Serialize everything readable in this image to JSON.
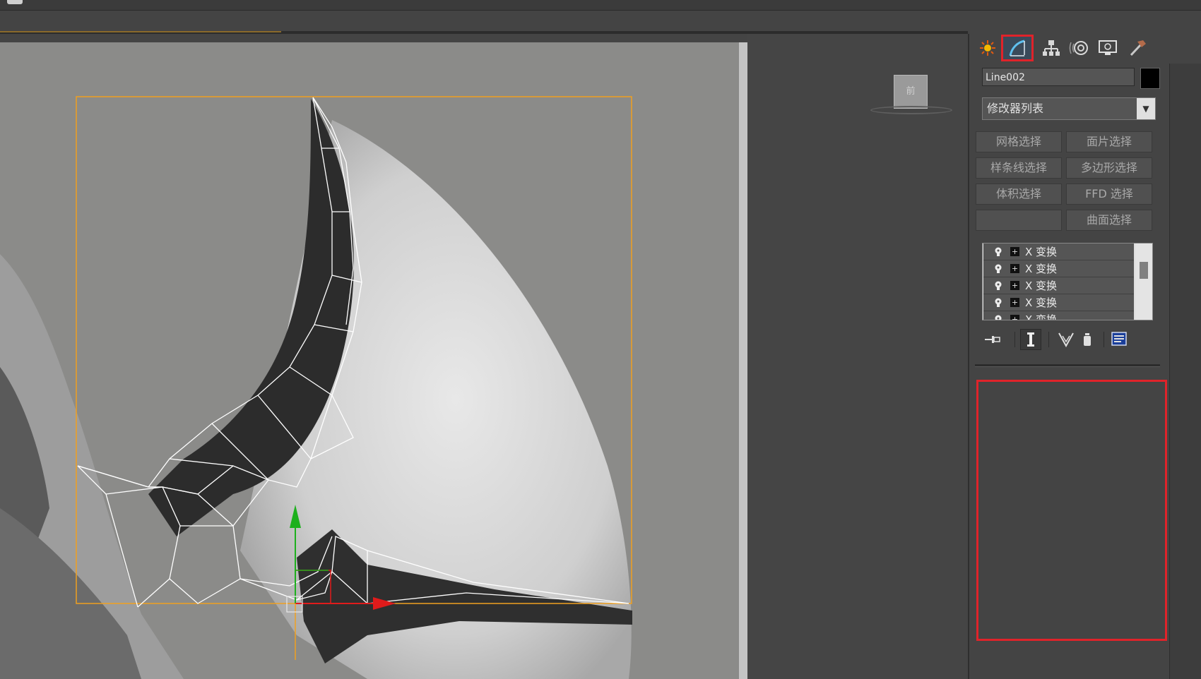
{
  "command_panel": {
    "tabs": [
      {
        "name": "create",
        "icon": "create-icon",
        "active": false
      },
      {
        "name": "modify",
        "icon": "modify-icon",
        "active": true
      },
      {
        "name": "hierarchy",
        "icon": "hierarchy-icon",
        "active": false
      },
      {
        "name": "motion",
        "icon": "motion-icon",
        "active": false
      },
      {
        "name": "display",
        "icon": "display-icon",
        "active": false
      },
      {
        "name": "utilities",
        "icon": "utilities-icon",
        "active": false
      }
    ],
    "object_name": "Line002",
    "object_color": "#000000",
    "modifier_list_label": "修改器列表",
    "modifier_buttons": [
      "网格选择",
      "面片选择",
      "样条线选择",
      "多边形选择",
      "体积选择",
      "FFD 选择",
      "",
      "曲面选择"
    ],
    "stack": [
      "X 变换",
      "X 变换",
      "X 变换",
      "X 变换",
      "X 变换"
    ],
    "highlight_color": "#e0232a"
  },
  "viewport": {
    "viewcube_label": "前",
    "selection_color": "#f0a020"
  }
}
